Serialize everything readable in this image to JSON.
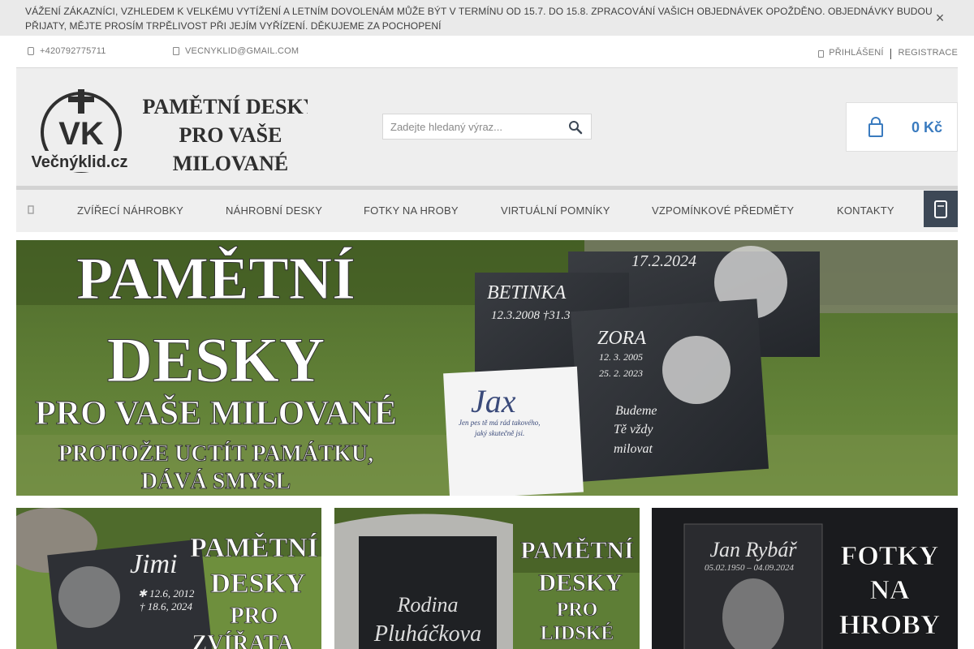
{
  "announcement": {
    "text": "Vážení zákazníci, vzhledem k velkému vytížení a letním dovolenám může být v termínu od 15.7. do 15.8. zpracování vašich objednávek opožděno. Objednávky budou přijaty, mějte prosím trpělivost při jejím vyřízení. Děkujeme za pochopení",
    "close_glyph": "×"
  },
  "topbar": {
    "phone": "+420792775711",
    "email": "VECNYKLID@GMAIL.COM",
    "login": "PŘIHLÁŠENÍ",
    "register": "REGISTRACE",
    "separator": "|"
  },
  "header": {
    "logo": {
      "brand": "Večnýklid.cz",
      "tagline_1": "PAMĚTNÍ DESKY",
      "tagline_2": "PRO VAŠE",
      "tagline_3": "MILOVANÉ",
      "monogram": "VK"
    },
    "search": {
      "placeholder": "Zadejte hledaný výraz..."
    },
    "cart": {
      "total": "0 Kč"
    }
  },
  "nav": {
    "items": [
      "ZVÍŘECÍ NÁHROBKY",
      "NÁHROBNÍ DESKY",
      "FOTKY NA HROBY",
      "VIRTUÁLNÍ POMNÍKY",
      "VZPOMÍNKOVÉ PŘEDMĚTY",
      "KONTAKTY"
    ]
  },
  "hero": {
    "line1": "PAMĚTNÍ",
    "line2": "DESKY",
    "line3": "PRO VAŠE MILOVANÉ",
    "line4": "PROTOŽE UCTÍT PAMÁTKU,",
    "line5": "DÁVÁ SMYSL",
    "plaque_date": "17.2.2024",
    "plaque_betinka": "BETINKA",
    "plaque_betinka_dates": "12.3.2008 †31.3",
    "plaque_zora": "ZORA",
    "plaque_zora_date1": "12. 3. 2005",
    "plaque_zora_date2": "25. 2. 2023",
    "plaque_zora_text1": "Budeme",
    "plaque_zora_text2": "Tě vždy",
    "plaque_zora_text3": "milovat",
    "plaque_jax": "Jax",
    "plaque_jax_text1": "Jen pes tě má rád takového,",
    "plaque_jax_text2": "jaký skutečně jsi."
  },
  "tiles": [
    {
      "heading1": "PAMĚTNÍ",
      "heading2": "DESKY",
      "heading3": "PRO",
      "heading4": "ZVÍŘATA",
      "plaque_name": "Jimi",
      "plaque_date1": "✱ 12.6, 2012",
      "plaque_date2": "† 18.6, 2024"
    },
    {
      "heading1": "PAMĚTNÍ",
      "heading2": "DESKY",
      "heading3": "PRO",
      "heading4": "LIDSKÉ",
      "plaque_line1": "Rodina",
      "plaque_line2": "Pluháčkova"
    },
    {
      "heading1": "FOTKY",
      "heading2": "NA",
      "heading3": "HROBY",
      "plaque_name": "Jan Rybář",
      "plaque_dates": "05.02.1950 – 04.09.2024"
    }
  ]
}
